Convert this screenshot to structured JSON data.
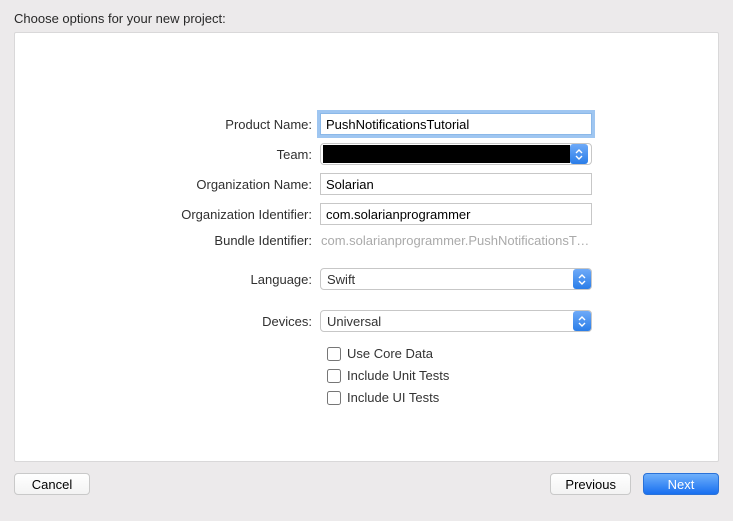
{
  "title": "Choose options for your new project:",
  "labels": {
    "productName": "Product Name:",
    "team": "Team:",
    "orgName": "Organization Name:",
    "orgIdentifier": "Organization Identifier:",
    "bundleIdentifier": "Bundle Identifier:",
    "language": "Language:",
    "devices": "Devices:"
  },
  "values": {
    "productName": "PushNotificationsTutorial",
    "team": "",
    "orgName": "Solarian",
    "orgIdentifier": "com.solarianprogrammer",
    "bundleIdentifier": "com.solarianprogrammer.PushNotificationsTuto…",
    "language": "Swift",
    "devices": "Universal"
  },
  "checkboxes": {
    "useCoreData": "Use Core Data",
    "includeUnitTests": "Include Unit Tests",
    "includeUITests": "Include UI Tests"
  },
  "buttons": {
    "cancel": "Cancel",
    "previous": "Previous",
    "next": "Next"
  }
}
